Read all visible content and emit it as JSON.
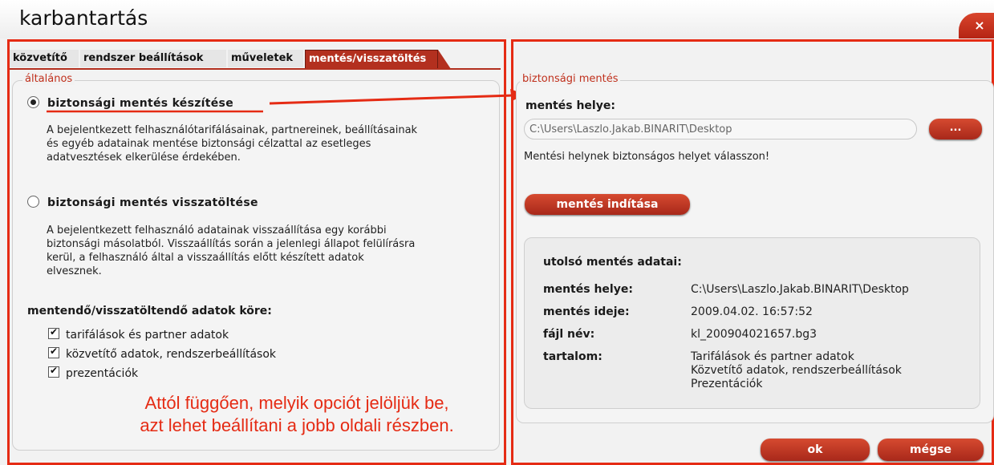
{
  "window": {
    "title": "karbantartás",
    "close_label": "×"
  },
  "tabs": [
    {
      "label": "közvetítő",
      "active": false
    },
    {
      "label": "rendszer beállítások",
      "active": false
    },
    {
      "label": "műveletek",
      "active": false
    },
    {
      "label": "mentés/visszatöltés",
      "active": true
    }
  ],
  "left": {
    "group_label": "általános",
    "option_backup": {
      "label": "biztonsági mentés készítése",
      "selected": true,
      "desc": [
        "A bejelentkezett felhasználótarifálásainak, partnereinek, beállításainak",
        "és egyéb adatainak mentése biztonsági célzattal az esetleges",
        "adatvesztések elkerülése érdekében."
      ]
    },
    "option_restore": {
      "label": "biztonsági mentés visszatöltése",
      "selected": false,
      "desc": [
        "A bejelentkezett felhasználó adatainak visszaállítása egy korábbi",
        "biztonsági másolatból. Visszaállítás során a jelenlegi állapot felülírásra",
        "kerül, a felhasználó által a visszaállítás előtt készített adatok",
        "elvesznek."
      ]
    },
    "scope_title": "mentendő/visszatöltendő adatok köre:",
    "checks": [
      {
        "label": "tarifálások és partner adatok",
        "checked": true
      },
      {
        "label": "közvetítő adatok, rendszerbeállítások",
        "checked": true
      },
      {
        "label": "prezentációk",
        "checked": true
      }
    ]
  },
  "annotation": {
    "line1": "Attól függően, melyik opciót jelöljük be,",
    "line2": "azt lehet beállítani a jobb oldali részben.",
    "color": "#e52b14"
  },
  "right": {
    "group_label": "biztonsági mentés",
    "location_label": "mentés helye:",
    "location_value": "C:\\Users\\Laszlo.Jakab.BINARIT\\Desktop",
    "browse_label": "...",
    "hint": "Mentési helynek biztonságos helyet válasszon!",
    "start_label": "mentés indítása",
    "last": {
      "title": "utolsó mentés adatai:",
      "rows": [
        {
          "key": "mentés helye:",
          "value": "C:\\Users\\Laszlo.Jakab.BINARIT\\Desktop"
        },
        {
          "key": "mentés ideje:",
          "value": "2009.04.02. 16:57:52"
        },
        {
          "key": "fájl név:",
          "value": "kl_200904021657.bg3"
        }
      ],
      "content_key": "tartalom:",
      "content_values": [
        "Tarifálások és partner adatok",
        "Közvetítő adatok, rendszerbeállítások",
        "Prezentációk"
      ]
    }
  },
  "footer": {
    "ok_label": "ok",
    "cancel_label": "mégse"
  },
  "colors": {
    "accent": "#b3301f",
    "annotation": "#e52b14"
  }
}
